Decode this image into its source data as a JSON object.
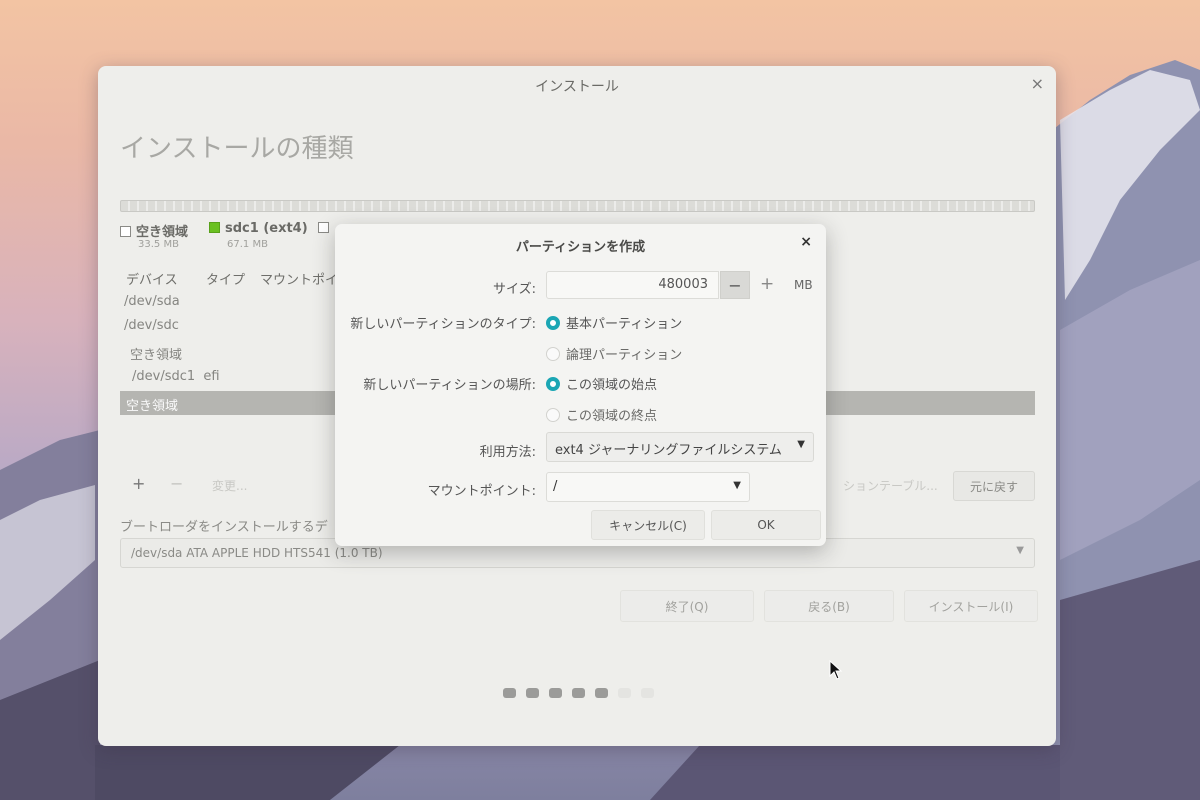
{
  "window": {
    "title": "インストール",
    "close_glyph": "×",
    "page_title": "インストールの種類"
  },
  "legend": [
    {
      "name": "空き領域",
      "size": "33.5 MB",
      "color": "#ffffff"
    },
    {
      "name": "sdc1 (ext4)",
      "size": "67.1 MB",
      "color": "#6ac021"
    }
  ],
  "table": {
    "columns": [
      "デバイス",
      "タイプ",
      "マウントポイ"
    ],
    "rows": [
      {
        "device": "/dev/sda",
        "type": ""
      },
      {
        "device": "/dev/sdc",
        "type": ""
      },
      {
        "device": "空き領域",
        "type": ""
      },
      {
        "device": "/dev/sdc1",
        "type": "efi"
      },
      {
        "device": "空き領域",
        "type": "",
        "selected": true
      }
    ]
  },
  "toolbar": {
    "add": "+",
    "remove": "−",
    "change": "変更...",
    "new_table": "ションテーブル...",
    "revert": "元に戻す"
  },
  "bootloader": {
    "label": "ブートローダをインストールするデ",
    "value": "/dev/sda   ATA APPLE HDD HTS541 (1.0 TB)"
  },
  "footer": {
    "quit": "終了(Q)",
    "back": "戻る(B)",
    "install": "インストール(I)"
  },
  "progress_dots": {
    "total": 7,
    "active": 5
  },
  "dialog": {
    "title": "パーティションを作成",
    "close_glyph": "×",
    "size_label": "サイズ:",
    "size_value": "480003",
    "minus": "−",
    "plus": "+",
    "unit": "MB",
    "type_label": "新しいパーティションのタイプ:",
    "type_options": [
      {
        "label": "基本パーティション",
        "checked": true
      },
      {
        "label": "論理パーティション",
        "checked": false
      }
    ],
    "location_label": "新しいパーティションの場所:",
    "location_options": [
      {
        "label": "この領域の始点",
        "checked": true
      },
      {
        "label": "この領域の終点",
        "checked": false
      }
    ],
    "use_label": "利用方法:",
    "use_value": "ext4 ジャーナリングファイルシステム",
    "mount_label": "マウントポイント:",
    "mount_value": "/",
    "cancel": "キャンセル(C)",
    "ok": "OK"
  },
  "colors": {
    "accent": "#1ba6b4",
    "partition_green": "#6ac021"
  }
}
